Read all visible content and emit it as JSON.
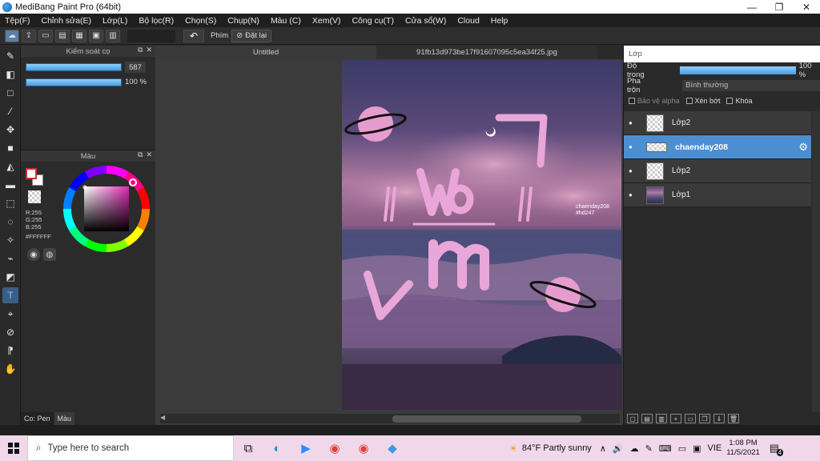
{
  "window": {
    "title": "MediBang Paint Pro (64bit)",
    "minimize": "—",
    "maximize": "❐",
    "close": "✕"
  },
  "menu": [
    "Tệp(F)",
    "Chỉnh sửa(E)",
    "Lớp(L)",
    "Bộ lọc(R)",
    "Chọn(S)",
    "Chụp(N)",
    "Màu (C)",
    "Xem(V)",
    "Công cụ(T)",
    "Cửa sổ(W)",
    "Cloud",
    "Help"
  ],
  "toolbar": {
    "phim_label": "Phím",
    "reset_label": "Đặt lại",
    "undo_icon": "↶"
  },
  "brush_panel": {
    "title": "Kiểm soát cọ",
    "size_value": "587",
    "opacity_value": "100 %",
    "size_level": 1.0,
    "opacity_level": 1.0
  },
  "color_panel": {
    "title": "Màu",
    "rgb_r": "R:255",
    "rgb_g": "G:255",
    "rgb_b": "B:255",
    "hex": "#FFFFFF",
    "foreground": "#d0312d",
    "background": "#ffffff"
  },
  "left_bottom_tabs": [
    "Co: Pen",
    "Màu"
  ],
  "canvas": {
    "tabs": [
      "Untitled",
      "91fb13d973be17f91607095c5ea34f25.jpg"
    ],
    "watermark_line1": "chaenday208",
    "watermark_line2": "#hd247"
  },
  "layer_panel": {
    "title": "Lớp",
    "opacity_label": "Độ trong",
    "opacity_value": "100 %",
    "opacity_level": 1.0,
    "blend_label": "Pha trộn",
    "blend_value": "Bình thường",
    "check_alpha": "Bảo vệ alpha",
    "check_clip": "Xén bớt",
    "check_lock": "Khóa",
    "layers": [
      {
        "name": "Lớp2",
        "selected": false
      },
      {
        "name": "chaenday208",
        "selected": true
      },
      {
        "name": "Lớp2",
        "selected": false
      },
      {
        "name": "Lớp1",
        "selected": false
      }
    ]
  },
  "taskbar": {
    "search_placeholder": "Type here to search",
    "weather": "84°F  Partly sunny",
    "lang": "VIE",
    "time": "1:08 PM",
    "date": "11/5/2021",
    "notification_count": "4"
  }
}
